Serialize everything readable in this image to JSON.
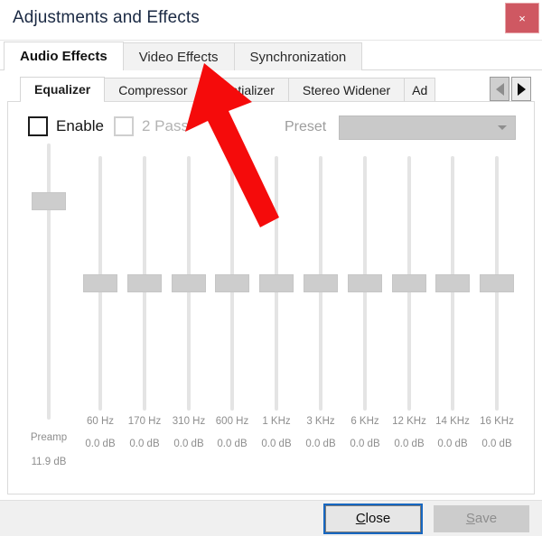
{
  "window": {
    "title": "Adjustments and Effects",
    "close_label": "×",
    "close_icon": "close-icon",
    "close_color": "#cf5862"
  },
  "outer_tabs": [
    {
      "label": "Audio Effects",
      "active": true
    },
    {
      "label": "Video Effects",
      "active": false
    },
    {
      "label": "Synchronization",
      "active": false
    }
  ],
  "inner_tabs": [
    {
      "label": "Equalizer",
      "active": true
    },
    {
      "label": "Compressor",
      "active": false
    },
    {
      "label": "Spatializer",
      "active": false
    },
    {
      "label": "Stereo Widener",
      "active": false
    },
    {
      "label": "Ad",
      "active": false,
      "clipped": true
    }
  ],
  "tab_scroll": {
    "left_label": "◀",
    "left_icon": "chevron-left-icon",
    "left_enabled": false,
    "right_label": "▶",
    "right_icon": "chevron-right-icon",
    "right_enabled": true
  },
  "controls": {
    "enable": {
      "label": "Enable",
      "checked": false,
      "disabled": false
    },
    "two_pass": {
      "label": "2 Pass",
      "checked": false,
      "disabled": true
    },
    "preset": {
      "label": "Preset",
      "value": "",
      "disabled": true,
      "caret_icon": "chevron-down-icon"
    }
  },
  "equalizer": {
    "preamp": {
      "name": "Preamp",
      "value": "11.9 dB",
      "position_pct": 21
    },
    "bands": [
      {
        "freq": "60 Hz",
        "gain": "0.0 dB",
        "position_pct": 50
      },
      {
        "freq": "170 Hz",
        "gain": "0.0 dB",
        "position_pct": 50
      },
      {
        "freq": "310 Hz",
        "gain": "0.0 dB",
        "position_pct": 50
      },
      {
        "freq": "600 Hz",
        "gain": "0.0 dB",
        "position_pct": 50
      },
      {
        "freq": "1 KHz",
        "gain": "0.0 dB",
        "position_pct": 50
      },
      {
        "freq": "3 KHz",
        "gain": "0.0 dB",
        "position_pct": 50
      },
      {
        "freq": "6 KHz",
        "gain": "0.0 dB",
        "position_pct": 50
      },
      {
        "freq": "12 KHz",
        "gain": "0.0 dB",
        "position_pct": 50
      },
      {
        "freq": "14 KHz",
        "gain": "0.0 dB",
        "position_pct": 50
      },
      {
        "freq": "16 KHz",
        "gain": "0.0 dB",
        "position_pct": 50
      }
    ]
  },
  "footer": {
    "close": {
      "label_prefix": "",
      "accel": "C",
      "label_suffix": "lose",
      "disabled": false,
      "focused": true
    },
    "save": {
      "label_prefix": "",
      "accel": "S",
      "label_suffix": "ave",
      "disabled": true,
      "focused": false
    }
  },
  "annotation": {
    "type": "red-arrow",
    "color": "#f50b0b",
    "points_to": "Video Effects"
  }
}
